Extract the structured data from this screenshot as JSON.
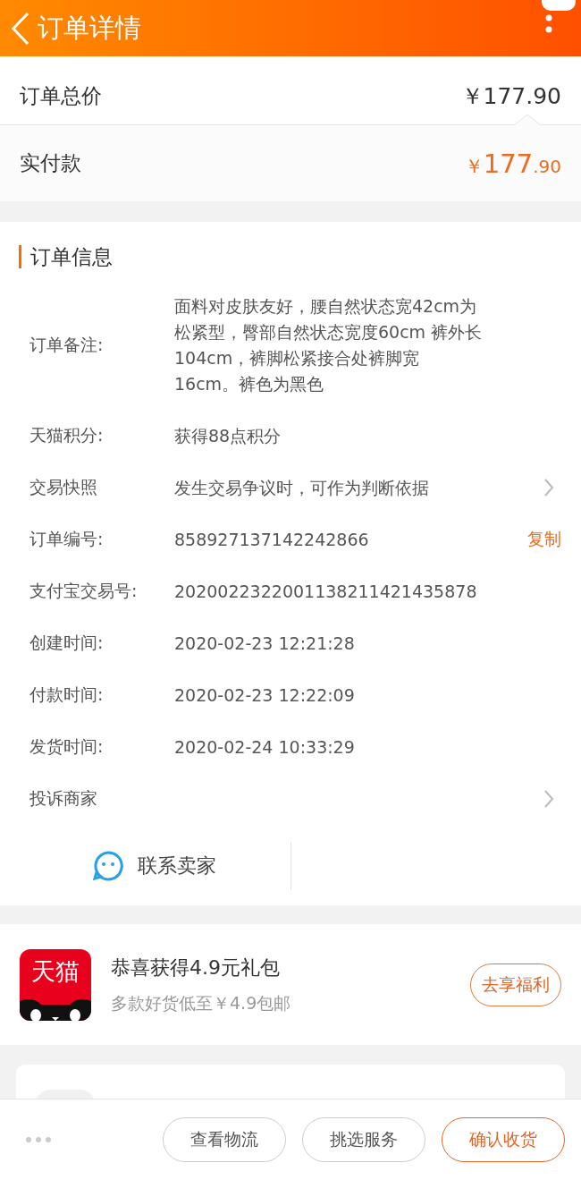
{
  "header": {
    "title": "订单详情"
  },
  "price_rows": [
    {
      "label": "订单总价",
      "value": "￥177.90",
      "kind": "total"
    }
  ],
  "paid": {
    "label": "实付款",
    "currency": "￥",
    "integer": "177",
    "decimal": ".90"
  },
  "order_info": {
    "title": "订单信息",
    "rows": [
      {
        "label": "订单备注:",
        "value": "面料对皮肤友好，腰自然状态宽42cm为松紧型，臀部自然状态宽度60cm  裤外长104cm，裤脚松紧接合处裤脚宽16cm。裤色为黑色",
        "kind": "plain"
      },
      {
        "label": "天猫积分:",
        "value": "获得88点积分",
        "kind": "plain"
      },
      {
        "label": "交易快照",
        "value": "发生交易争议时，可作为判断依据",
        "kind": "link"
      },
      {
        "label": "订单编号:",
        "value": "858927137142242866",
        "kind": "copy",
        "action": "复制"
      },
      {
        "label": "支付宝交易号:",
        "value": "2020022322001138211421435878",
        "kind": "plain"
      },
      {
        "label": "创建时间:",
        "value": "2020-02-23 12:21:28",
        "kind": "plain"
      },
      {
        "label": "付款时间:",
        "value": "2020-02-23 12:22:09",
        "kind": "plain"
      },
      {
        "label": "发货时间:",
        "value": "2020-02-24 10:33:29",
        "kind": "plain"
      },
      {
        "label": "投诉商家",
        "kind": "link"
      }
    ],
    "contact": "联系卖家"
  },
  "promo": {
    "logo": "天猫",
    "title": "恭喜获得4.9元礼包",
    "subtitle": "多款好货低至￥4.9包邮",
    "button": "去享福利"
  },
  "bottom_bar": {
    "buttons": [
      {
        "label": "查看物流",
        "primary": false
      },
      {
        "label": "挑选服务",
        "primary": false
      },
      {
        "label": "确认收货",
        "primary": true
      }
    ]
  }
}
